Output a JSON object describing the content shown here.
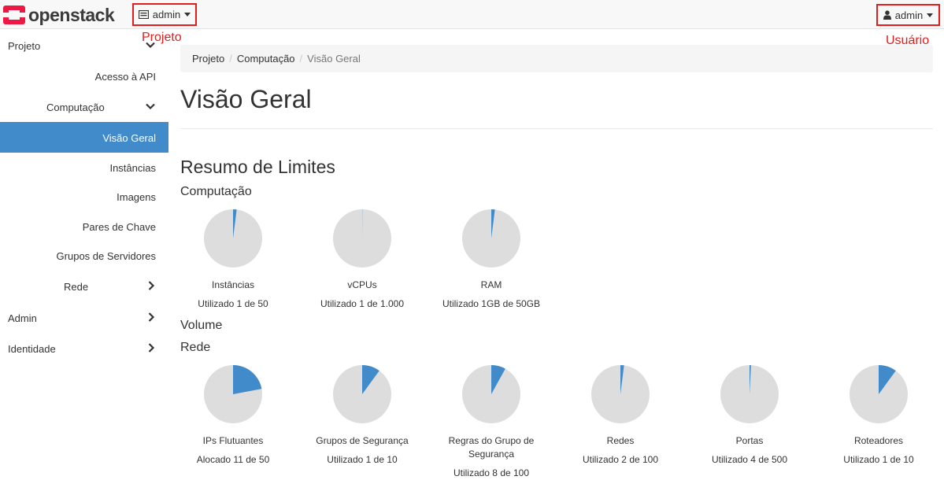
{
  "header": {
    "brand": "openstack",
    "project_dropdown": "admin",
    "user_dropdown": "admin",
    "annotation_project": "Projeto",
    "annotation_user": "Usuário"
  },
  "sidebar": {
    "items": [
      {
        "label": "Projeto",
        "chevron": "down"
      },
      {
        "label": "Acesso à API"
      },
      {
        "label": "Computação",
        "chevron": "down"
      },
      {
        "label": "Visão Geral",
        "active": true
      },
      {
        "label": "Instâncias"
      },
      {
        "label": "Imagens"
      },
      {
        "label": "Pares de Chave"
      },
      {
        "label": "Grupos de Servidores"
      },
      {
        "label": "Rede",
        "chevron": "right"
      },
      {
        "label": "Admin",
        "chevron": "right"
      },
      {
        "label": "Identidade",
        "chevron": "right"
      }
    ]
  },
  "breadcrumb": {
    "items": [
      "Projeto",
      "Computação",
      "Visão Geral"
    ],
    "separator": "/"
  },
  "main": {
    "title": "Visão Geral",
    "limits_heading": "Resumo de Limites",
    "sections": {
      "compute": "Computação",
      "volume": "Volume",
      "network": "Rede"
    },
    "compute_pies": [
      {
        "name": "Instâncias",
        "usage": "Utilizado 1 de 50",
        "used": 1,
        "total": 50
      },
      {
        "name": "vCPUs",
        "usage": "Utilizado 1 de 1.000",
        "used": 1,
        "total": 1000
      },
      {
        "name": "RAM",
        "usage": "Utilizado 1GB de 50GB",
        "used": 1,
        "total": 50
      }
    ],
    "network_pies": [
      {
        "name": "IPs Flutuantes",
        "usage": "Alocado 11 de 50",
        "used": 11,
        "total": 50
      },
      {
        "name": "Grupos de Segurança",
        "usage": "Utilizado 1 de 10",
        "used": 1,
        "total": 10
      },
      {
        "name": "Regras do Grupo de Segurança",
        "usage": "Utilizado 8 de 100",
        "used": 8,
        "total": 100
      },
      {
        "name": "Redes",
        "usage": "Utilizado 2 de 100",
        "used": 2,
        "total": 100
      },
      {
        "name": "Portas",
        "usage": "Utilizado 4 de 500",
        "used": 4,
        "total": 500
      },
      {
        "name": "Roteadores",
        "usage": "Utilizado 1 de 10",
        "used": 1,
        "total": 10
      }
    ],
    "colors": {
      "used": "#428bca",
      "free": "#dddddd",
      "active_nav": "#428bca",
      "annotation": "#e21d1d"
    }
  }
}
